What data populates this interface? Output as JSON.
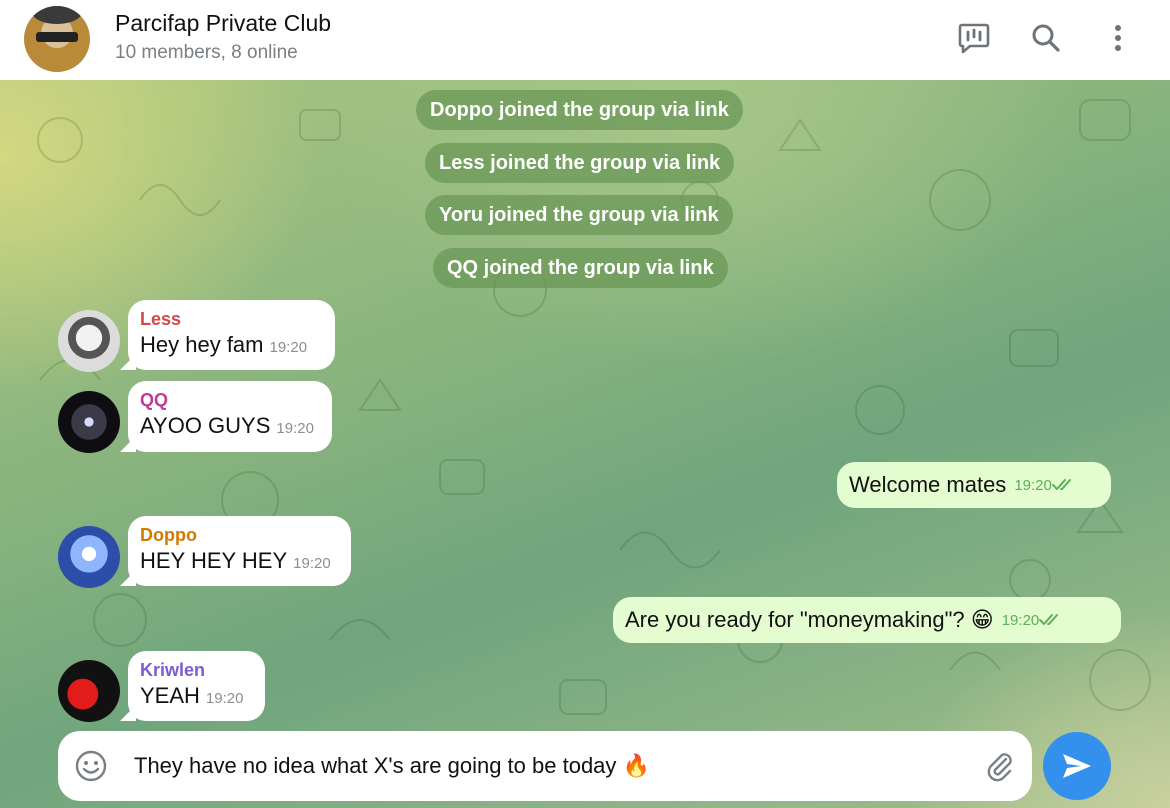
{
  "header": {
    "title": "Parcifap Private Club",
    "subtitle": "10 members, 8 online",
    "icons": [
      "live-stream-icon",
      "search-icon",
      "more-vertical-icon"
    ]
  },
  "service_messages": [
    "Doppo joined the group via link",
    "Less joined the group via link",
    "Yoru joined the group via link",
    "QQ joined the group via link"
  ],
  "incoming": [
    {
      "name": "Less",
      "name_color": "#d1494b",
      "text": "Hey hey fam",
      "time": "19:20"
    },
    {
      "name": "QQ",
      "name_color": "#c0399b",
      "text": "AYOO GUYS",
      "time": "19:20"
    },
    {
      "name": "Doppo",
      "name_color": "#d07a00",
      "text": "HEY HEY HEY",
      "time": "19:20"
    },
    {
      "name": "Kriwlen",
      "name_color": "#7b5bd6",
      "text": "YEAH",
      "time": "19:20"
    }
  ],
  "outgoing": [
    {
      "text": "Welcome mates",
      "time": "19:20"
    },
    {
      "text": "Are you ready for \"moneymaking\"? 😁",
      "time": "19:20"
    }
  ],
  "composer": {
    "value": "They have no idea what X's are going to be today 🔥"
  },
  "colors": {
    "accent": "#3390ec",
    "outgoing_bubble": "#e3fdd1",
    "check": "#5fae56"
  }
}
